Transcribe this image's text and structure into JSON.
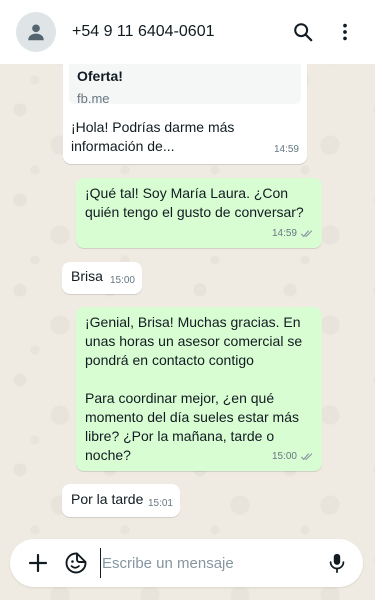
{
  "header": {
    "contact_name": "+54 9 11 6404-0601"
  },
  "messages": [
    {
      "direction": "in",
      "link_preview": {
        "title": "Oferta!",
        "site": "fb.me"
      },
      "text": "¡Hola! Podrías darme más información de...",
      "time": "14:59"
    },
    {
      "direction": "out",
      "text": "¡Qué tal! Soy María Laura. ¿Con quién tengo el gusto de conversar?",
      "time": "14:59",
      "status": "read"
    },
    {
      "direction": "in",
      "text": "Brisa",
      "time": "15:00"
    },
    {
      "direction": "out",
      "text": "¡Genial, Brisa! Muchas gracias. En unas horas un asesor comercial se pondrá en contacto contigo\n\nPara coordinar mejor, ¿en qué momento del día sueles estar más libre? ¿Por la mañana, tarde o noche?",
      "time": "15:00",
      "status": "read"
    },
    {
      "direction": "in",
      "text": "Por la tarde",
      "time": "15:01"
    }
  ],
  "composer": {
    "placeholder": "Escribe un mensaje",
    "value": ""
  },
  "icons": {
    "header": [
      "avatar-icon",
      "search-icon",
      "more-vertical-icon"
    ],
    "composer": [
      "plus-icon",
      "sticker-icon",
      "microphone-icon"
    ],
    "message_status": "double-check-icon"
  },
  "colors": {
    "wallpaper": "#efeae2",
    "incoming_bubble": "#ffffff",
    "outgoing_bubble": "#d9fdd3",
    "read_ticks": "#53bdeb",
    "secondary_text": "#667781"
  }
}
